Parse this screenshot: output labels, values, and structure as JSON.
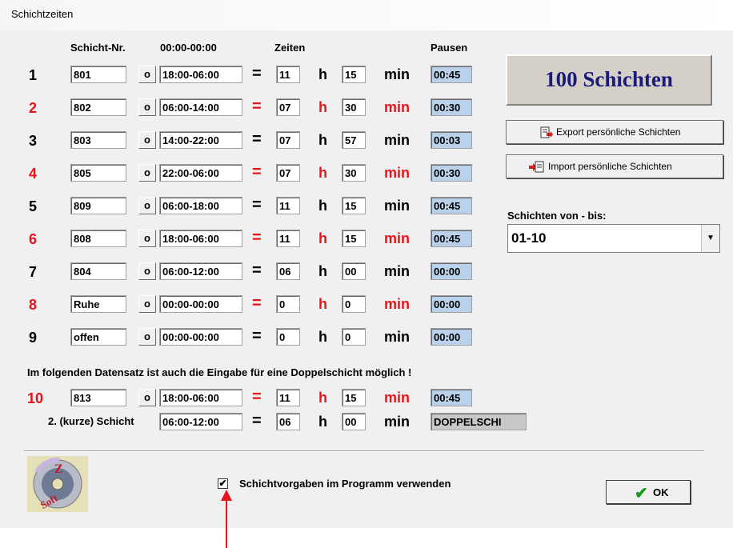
{
  "window": {
    "title": "Schichtzeiten"
  },
  "headers": {
    "schicht_nr": "Schicht-Nr.",
    "time_format": "00:00-00:00",
    "zeiten": "Zeiten",
    "pausen": "Pausen"
  },
  "symbols": {
    "p_button": "o",
    "eq": "=",
    "hours_unit": "h",
    "minutes_unit": "min"
  },
  "rows": [
    {
      "num": "1",
      "color": "#000000",
      "nr": "801",
      "time": "18:00-06:00",
      "h": "11",
      "m": "15",
      "pause": "00:45"
    },
    {
      "num": "2",
      "color": "#e8141b",
      "nr": "802",
      "time": "06:00-14:00",
      "h": "07",
      "m": "30",
      "pause": "00:30"
    },
    {
      "num": "3",
      "color": "#000000",
      "nr": "803",
      "time": "14:00-22:00",
      "h": "07",
      "m": "57",
      "pause": "00:03"
    },
    {
      "num": "4",
      "color": "#e8141b",
      "nr": "805",
      "time": "22:00-06:00",
      "h": "07",
      "m": "30",
      "pause": "00:30"
    },
    {
      "num": "5",
      "color": "#000000",
      "nr": "809",
      "time": "06:00-18:00",
      "h": "11",
      "m": "15",
      "pause": "00:45"
    },
    {
      "num": "6",
      "color": "#e8141b",
      "nr": "808",
      "time": "18:00-06:00",
      "h": "11",
      "m": "15",
      "pause": "00:45"
    },
    {
      "num": "7",
      "color": "#000000",
      "nr": "804",
      "time": "06:00-12:00",
      "h": "06",
      "m": "00",
      "pause": "00:00"
    },
    {
      "num": "8",
      "color": "#e8141b",
      "nr": "Ruhe",
      "time": "00:00-00:00",
      "h": "0",
      "m": "0",
      "pause": "00:00"
    },
    {
      "num": "9",
      "color": "#000000",
      "nr": "offen",
      "time": "00:00-00:00",
      "h": "0",
      "m": "0",
      "pause": "00:00"
    }
  ],
  "notice": "Im folgenden Datensatz ist auch die Eingabe für eine Doppelschicht möglich !",
  "row10": {
    "num": "10",
    "nr": "813",
    "time": "18:00-06:00",
    "h": "11",
    "m": "15",
    "pause": "00:45"
  },
  "short_shift": {
    "label": "2. (kurze) Schicht",
    "time": "06:00-12:00",
    "h": "06",
    "m": "00",
    "status": "DOPPELSCHI"
  },
  "side": {
    "count_label": "100 Schichten",
    "export_label": "Export persönliche Schichten",
    "import_label": "Import persönliche  Schichten",
    "range_label": "Schichten von - bis:",
    "range_value": "01-10"
  },
  "footer": {
    "checkbox_label": "Schichtvorgaben im Programm verwenden",
    "checkbox_checked": true,
    "ok_label": "OK"
  },
  "colors": {
    "red": "#e8141b",
    "pause_bg": "#b9d1ea",
    "accent_arrow": "#e8141b"
  }
}
